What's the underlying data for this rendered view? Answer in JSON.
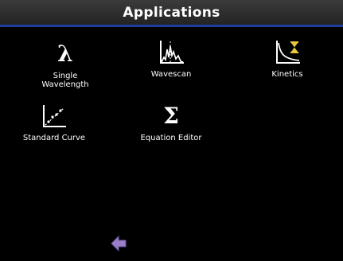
{
  "header": {
    "title": "Applications"
  },
  "apps": [
    {
      "label_line1": "Single",
      "label_line2": "Wavelength",
      "icon": "lambda-icon",
      "glyph": "λ"
    },
    {
      "label_line1": "Wavescan",
      "label_line2": "",
      "icon": "wavescan-icon"
    },
    {
      "label_line1": "Kinetics",
      "label_line2": "",
      "icon": "kinetics-icon"
    },
    {
      "label_line1": "Standard Curve",
      "label_line2": "",
      "icon": "standard-curve-icon"
    },
    {
      "label_line1": "Equation Editor",
      "label_line2": "",
      "icon": "sigma-icon",
      "glyph": "Σ"
    }
  ],
  "footer": {
    "back_icon": "back-arrow-icon"
  },
  "colors": {
    "background": "#000000",
    "title_bar": "#2e2e2e",
    "title_underline": "#1e3f9c",
    "back_arrow": "#9a7fc8",
    "hourglass": "#e8c840"
  }
}
